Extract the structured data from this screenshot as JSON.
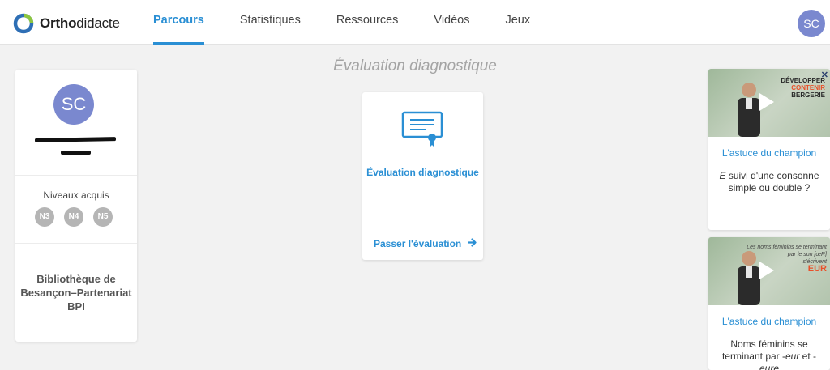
{
  "header": {
    "logo": {
      "bold": "Ortho",
      "regular": "didacte"
    },
    "nav": [
      {
        "label": "Parcours",
        "active": true
      },
      {
        "label": "Statistiques",
        "active": false
      },
      {
        "label": "Ressources",
        "active": false
      },
      {
        "label": "Vidéos",
        "active": false
      },
      {
        "label": "Jeux",
        "active": false
      }
    ],
    "avatar_initials": "SC"
  },
  "page_title": "Évaluation diagnostique",
  "profile": {
    "initials": "SC",
    "levels_label": "Niveaux acquis",
    "levels": [
      "N3",
      "N4",
      "N5"
    ],
    "library": "Bibliothèque de Besançon–Partenariat BPI"
  },
  "evaluation": {
    "title": "Évaluation diagnostique",
    "action_label": "Passer l'évaluation",
    "action_arrow": "→"
  },
  "videos": [
    {
      "thumb_text": [
        "DÉVELOPPER",
        "CONTENIR",
        "BERGERIE"
      ],
      "title": "L'astuce du champion",
      "desc_em": "E",
      "desc_rest": " suivi d'une consonne simple ou double ?"
    },
    {
      "thumb_text": [
        "Les noms féminins se terminant",
        "par le son [œR]",
        "s'écrivent",
        "EUR"
      ],
      "title": "L'astuce du champion",
      "desc_prefix": "Noms féminins se terminant par -",
      "desc_em1": "eur",
      "desc_mid": " et -",
      "desc_em2": "eure"
    }
  ],
  "colors": {
    "accent": "#2a8fd4",
    "avatar": "#7a88cf",
    "level_badge": "#b5b5b5"
  }
}
